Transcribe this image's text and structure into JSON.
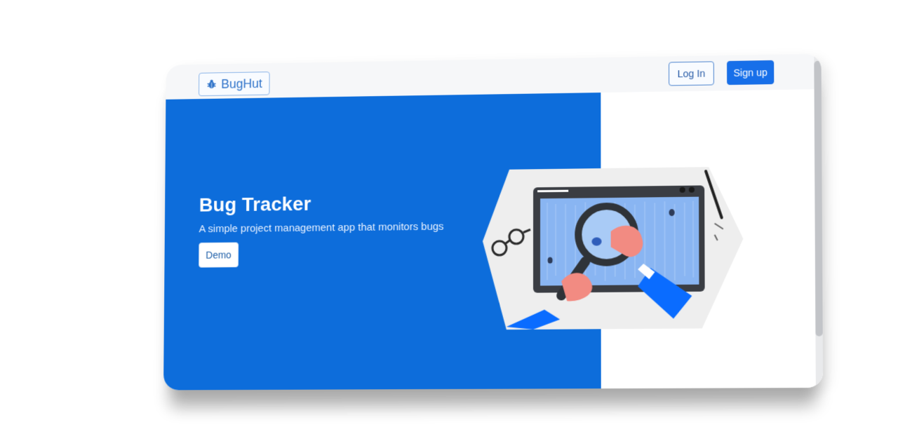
{
  "navbar": {
    "brand": {
      "label": "BugHut",
      "icon": "bug-icon"
    },
    "login_label": "Log In",
    "signup_label": "Sign up"
  },
  "hero": {
    "title": "Bug Tracker",
    "subtitle": "A simple project management app that monitors bugs",
    "demo_label": "Demo",
    "illustration": "bug-search-illustration"
  },
  "colors": {
    "hero_bg": "#0d6ddb",
    "navbar_bg": "#f6f7f9",
    "brand_text": "#2f73c9",
    "primary_button": "#176fe9",
    "accent_blue": "#0a6cff"
  }
}
